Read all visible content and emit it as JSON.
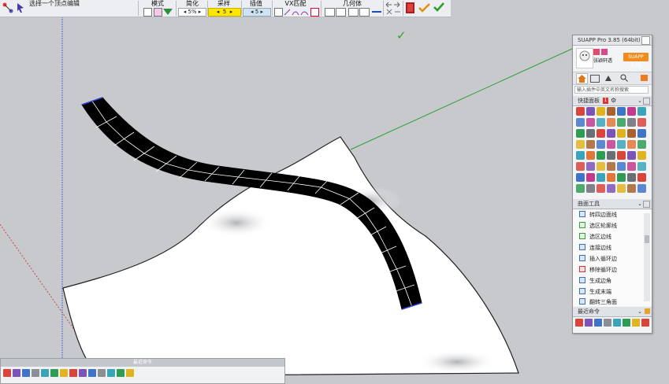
{
  "toolbar": {
    "hint": "选择一个顶点编辑",
    "groups": {
      "mode": "模式",
      "simplify": "简化",
      "sample": "采样",
      "interp": "插值",
      "vx": "VX匹配",
      "geometry": "几何体"
    },
    "simplify_value": "5%",
    "sample_value": "5",
    "interp_value": "5",
    "step_left": "◂",
    "step_right": "▸"
  },
  "suapp": {
    "title": "SUAPP Pro 3.85 (64bit)",
    "username": "张颖轩透",
    "badge": "SUAPP 3.85",
    "search_placeholder": "输入插件中英文名称搜索",
    "quick_panel": "快捷面板",
    "quick_count": "1",
    "curve_tools": "曲面工具",
    "tools": [
      "转四边面线",
      "选区轮廓线",
      "选区边线",
      "连接边线",
      "插入循环边",
      "移除循环边",
      "生成边角",
      "生成末端",
      "翻转三角面"
    ],
    "recent": "最近命令"
  },
  "recent_panel": {
    "title": "最近命令"
  },
  "colors": {
    "axis_green": "#2f9e3a",
    "axis_blue": "#4a5fd6",
    "axis_red": "#c23a3a",
    "viewport_bg": "#c8c9cd",
    "panel_bg": "#f3f4f6",
    "check_green": "#2aa12a"
  },
  "icons": [
    "check-mark-icon",
    "undo-icon",
    "redo-icon",
    "home-icon",
    "search-icon",
    "gear-icon",
    "chevron-down-icon"
  ]
}
